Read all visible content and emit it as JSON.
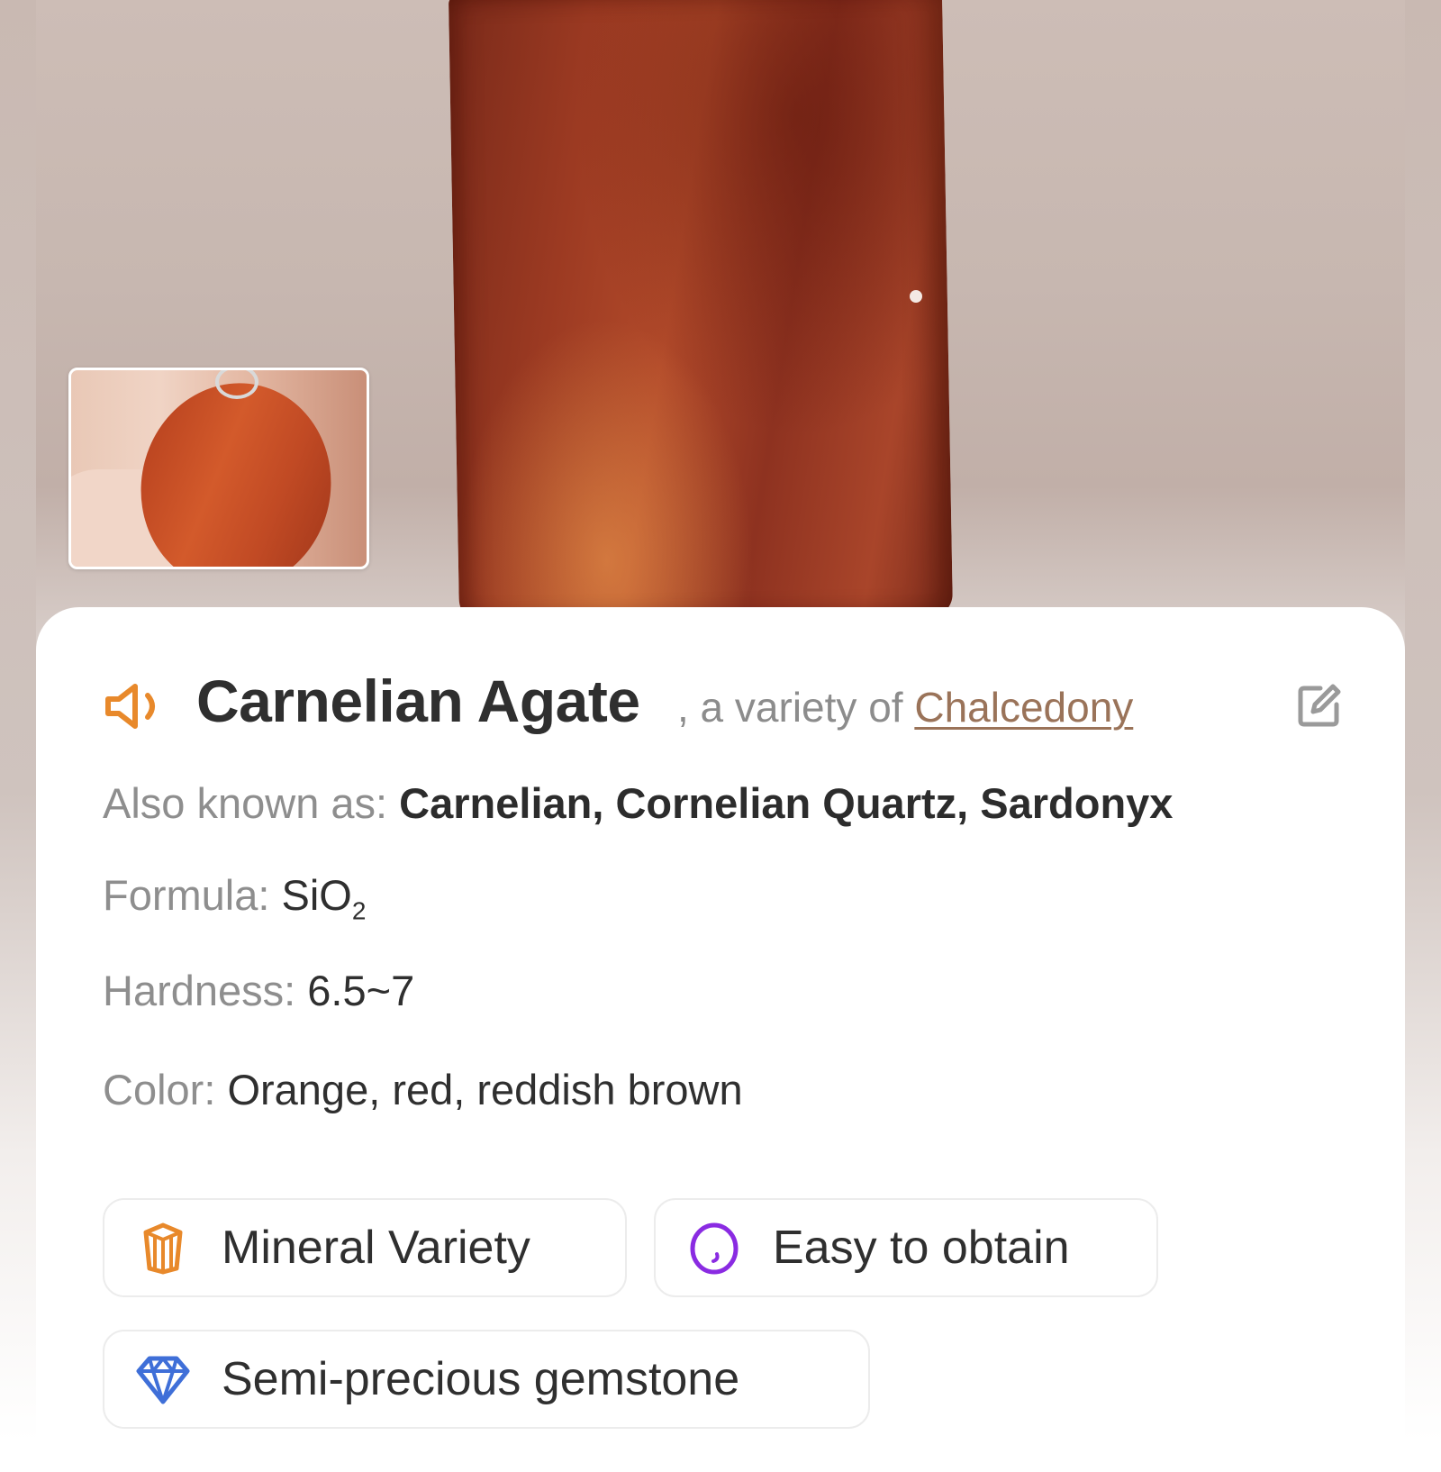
{
  "specimen": {
    "name": "Carnelian Agate",
    "variety_prefix": ", a variety of ",
    "variety_link": "Chalcedony"
  },
  "properties": {
    "aka_label": "Also known as: ",
    "aka_value": "Carnelian, Cornelian Quartz, Sardonyx",
    "formula_label": "Formula: ",
    "formula_main": "SiO",
    "formula_sub": "2",
    "hardness_label": "Hardness: ",
    "hardness_value": "6.5~7",
    "color_label": "Color: ",
    "color_value": "Orange, red, reddish brown"
  },
  "tags": [
    {
      "label": "Mineral Variety",
      "icon": "crystal-icon",
      "color": "#e8892b"
    },
    {
      "label": "Easy to obtain",
      "icon": "oval-gem-icon",
      "color": "#8a2be2"
    },
    {
      "label": "Semi-precious gemstone",
      "icon": "diamond-icon",
      "color": "#3f6fd8"
    }
  ],
  "icons": {
    "speaker": "speaker-icon",
    "edit": "edit-icon"
  },
  "colors": {
    "accent_orange": "#e8892b",
    "link_brown": "#9a7359",
    "label_gray": "#8e8e8e",
    "text_dark": "#2f2f2f"
  }
}
